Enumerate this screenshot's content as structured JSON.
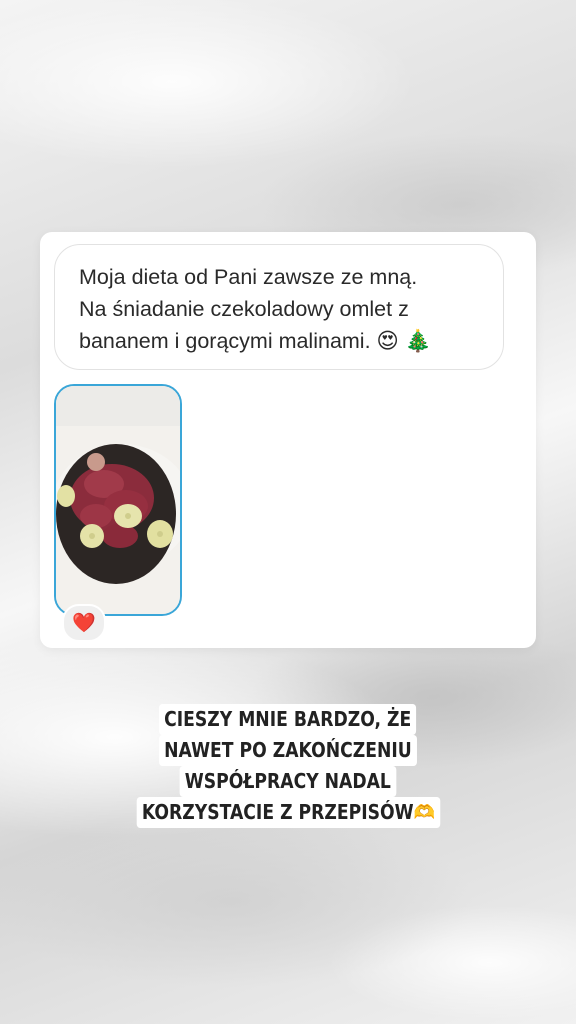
{
  "message": {
    "lines": [
      "Moja dieta od Pani zawsze ze mną.",
      "Na śniadanie czekoladowy omlet z",
      "bananem i gorącymi malinami. 😍 🎄"
    ]
  },
  "reaction": {
    "emoji": "❤️"
  },
  "caption": {
    "lines": [
      "CIESZY MNIE BARDZO, ŻE",
      "NAWET PO ZAKOŃCZENIU",
      "WSPÓŁPRACY NADAL",
      "KORZYSTACIE Z PRZEPISÓW🫶"
    ]
  },
  "colors": {
    "photo_border": "#3aa6d8",
    "heart": "#e01d2c"
  }
}
